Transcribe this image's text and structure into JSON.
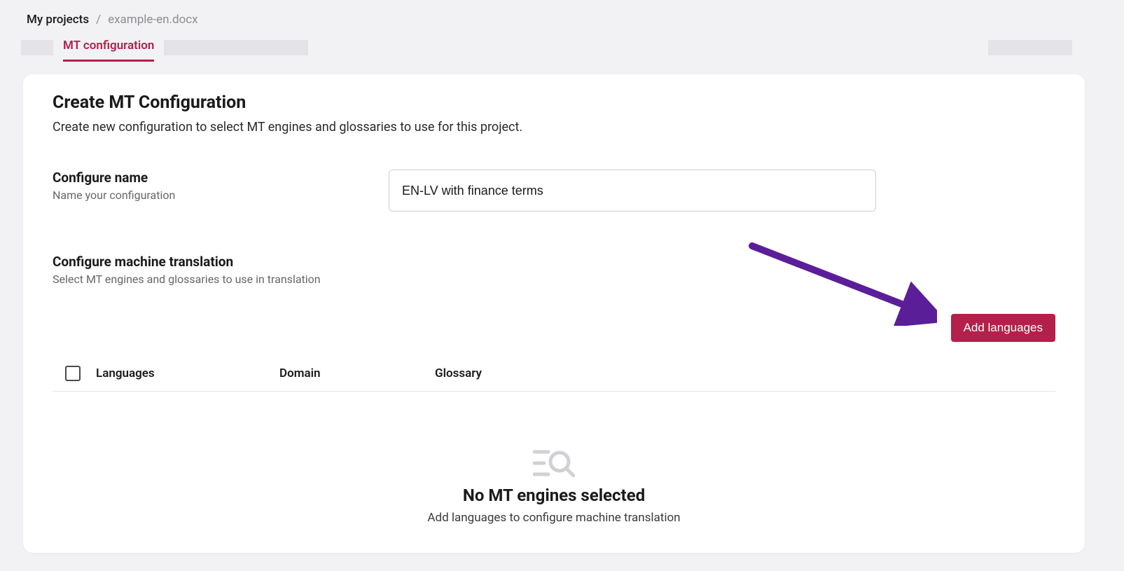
{
  "breadcrumb": {
    "root": "My projects",
    "current": "example-en.docx"
  },
  "tabs": {
    "active_label": "MT configuration"
  },
  "page": {
    "title": "Create MT Configuration",
    "description": "Create new configuration to select MT engines and glossaries to use for this project."
  },
  "form": {
    "configure_name_label": "Configure name",
    "configure_name_hint": "Name your configuration",
    "configure_name_value": "EN-LV with finance terms",
    "configure_mt_label": "Configure machine translation",
    "configure_mt_hint": "Select MT engines and glossaries to use in translation",
    "add_languages_label": "Add languages"
  },
  "table": {
    "headers": {
      "languages": "Languages",
      "domain": "Domain",
      "glossary": "Glossary"
    }
  },
  "empty_state": {
    "title": "No MT engines selected",
    "subtitle": "Add languages to configure machine translation"
  },
  "colors": {
    "accent": "#b3204b",
    "arrow": "#5b1e99"
  }
}
